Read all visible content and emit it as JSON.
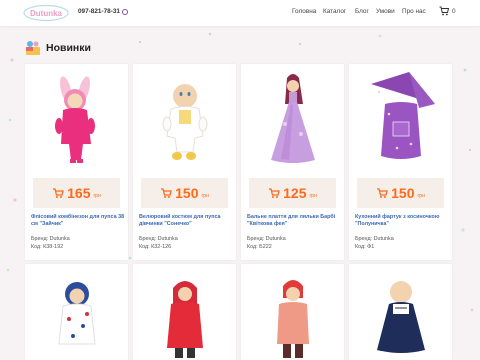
{
  "header": {
    "logo_text": "Dutunka",
    "phone": "097-821-78-31",
    "nav": [
      "Головна",
      "Каталог",
      "Блог",
      "Умови",
      "Про нас"
    ],
    "cart_count": "0"
  },
  "section": {
    "title": "Новинки"
  },
  "products": [
    {
      "price": "165",
      "currency": "грн",
      "name": "Флісовий комбінезон для пупса 38 см \"Зайчик\"",
      "brand": "Бренд: Dutunka",
      "code": "Код: К38-192"
    },
    {
      "price": "150",
      "currency": "грн",
      "name": "Велюровий костюм для пупса дівчинки \"Сонечко\"",
      "brand": "Бренд: Dutunka",
      "code": "Код: К32-126"
    },
    {
      "price": "125",
      "currency": "грн",
      "name": "Бальне плаття для ляльки Барбі \"Квіткова фея\"",
      "brand": "Бренд: Dutunka",
      "code": "Код: Б222"
    },
    {
      "price": "150",
      "currency": "грн",
      "name": "Кухонний фартук з косиночкою \"Полуничка\"",
      "brand": "Бренд: Dutunka",
      "code": "Код: Ф1"
    },
    {},
    {},
    {},
    {}
  ],
  "colors": {
    "accent": "#ff6a1a",
    "link": "#3b69b3",
    "price_bg": "#f6eee8"
  }
}
